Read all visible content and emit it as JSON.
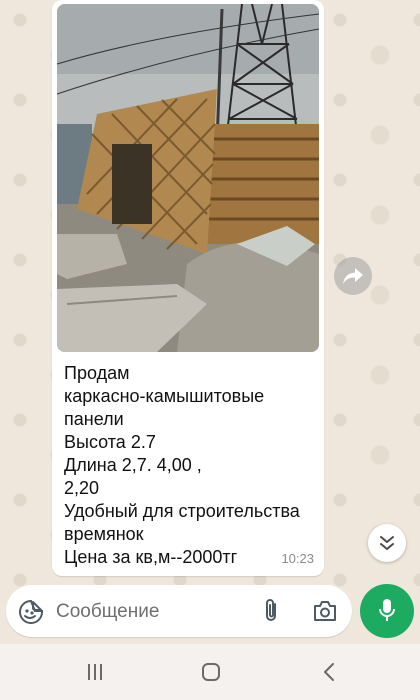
{
  "message": {
    "lines": [
      "Продам",
      "каркасно-камышитовые",
      "панели",
      "Высота 2.7",
      "Длина 2,7. 4,00 ,",
      "2,20",
      "Удобный для строительства",
      "времянок",
      "Цена за кв,м--2000тг"
    ],
    "time": "10:23",
    "photo_icon": "photo-wooden-frame-panels"
  },
  "input": {
    "placeholder": "Сообщение",
    "value": ""
  },
  "icons": {
    "forward": "forward-icon",
    "scroll_down": "double-chevron-down-icon",
    "emoji": "sticker-emoji-icon",
    "attach": "paperclip-icon",
    "camera": "camera-icon",
    "mic": "microphone-icon",
    "nav_recents": "recents-icon",
    "nav_home": "home-icon",
    "nav_back": "back-icon"
  },
  "colors": {
    "wallpaper": "#efe7dc",
    "bubble": "#ffffff",
    "accent_green": "#1daa61",
    "navbar": "#f4f1ee"
  }
}
